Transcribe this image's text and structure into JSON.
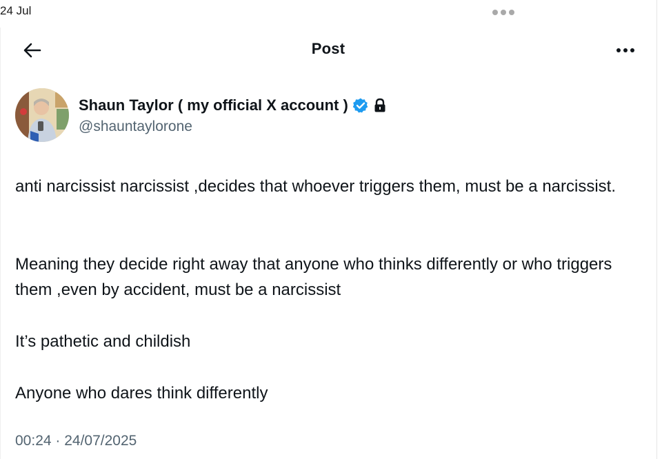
{
  "status_bar": {
    "date": "24 Jul"
  },
  "header": {
    "title": "Post"
  },
  "author": {
    "display_name": "Shaun Taylor ( my official X account )",
    "handle": "@shauntaylorone",
    "verified_icon": "verified-badge-icon",
    "lock_icon": "lock-icon"
  },
  "post": {
    "paragraphs": [
      "anti narcissist narcissist ,decides that whoever triggers them, must be a narcissist.",
      "Meaning they decide right away that anyone who thinks differently or who triggers them ,even by accident, must be a narcissist",
      "It’s pathetic and childish",
      "Anyone who dares think differently"
    ],
    "timestamp": "00:24 · 24/07/2025"
  },
  "colors": {
    "text_primary": "#0f1419",
    "text_secondary": "#536471",
    "verified_blue": "#1d9bf0"
  }
}
